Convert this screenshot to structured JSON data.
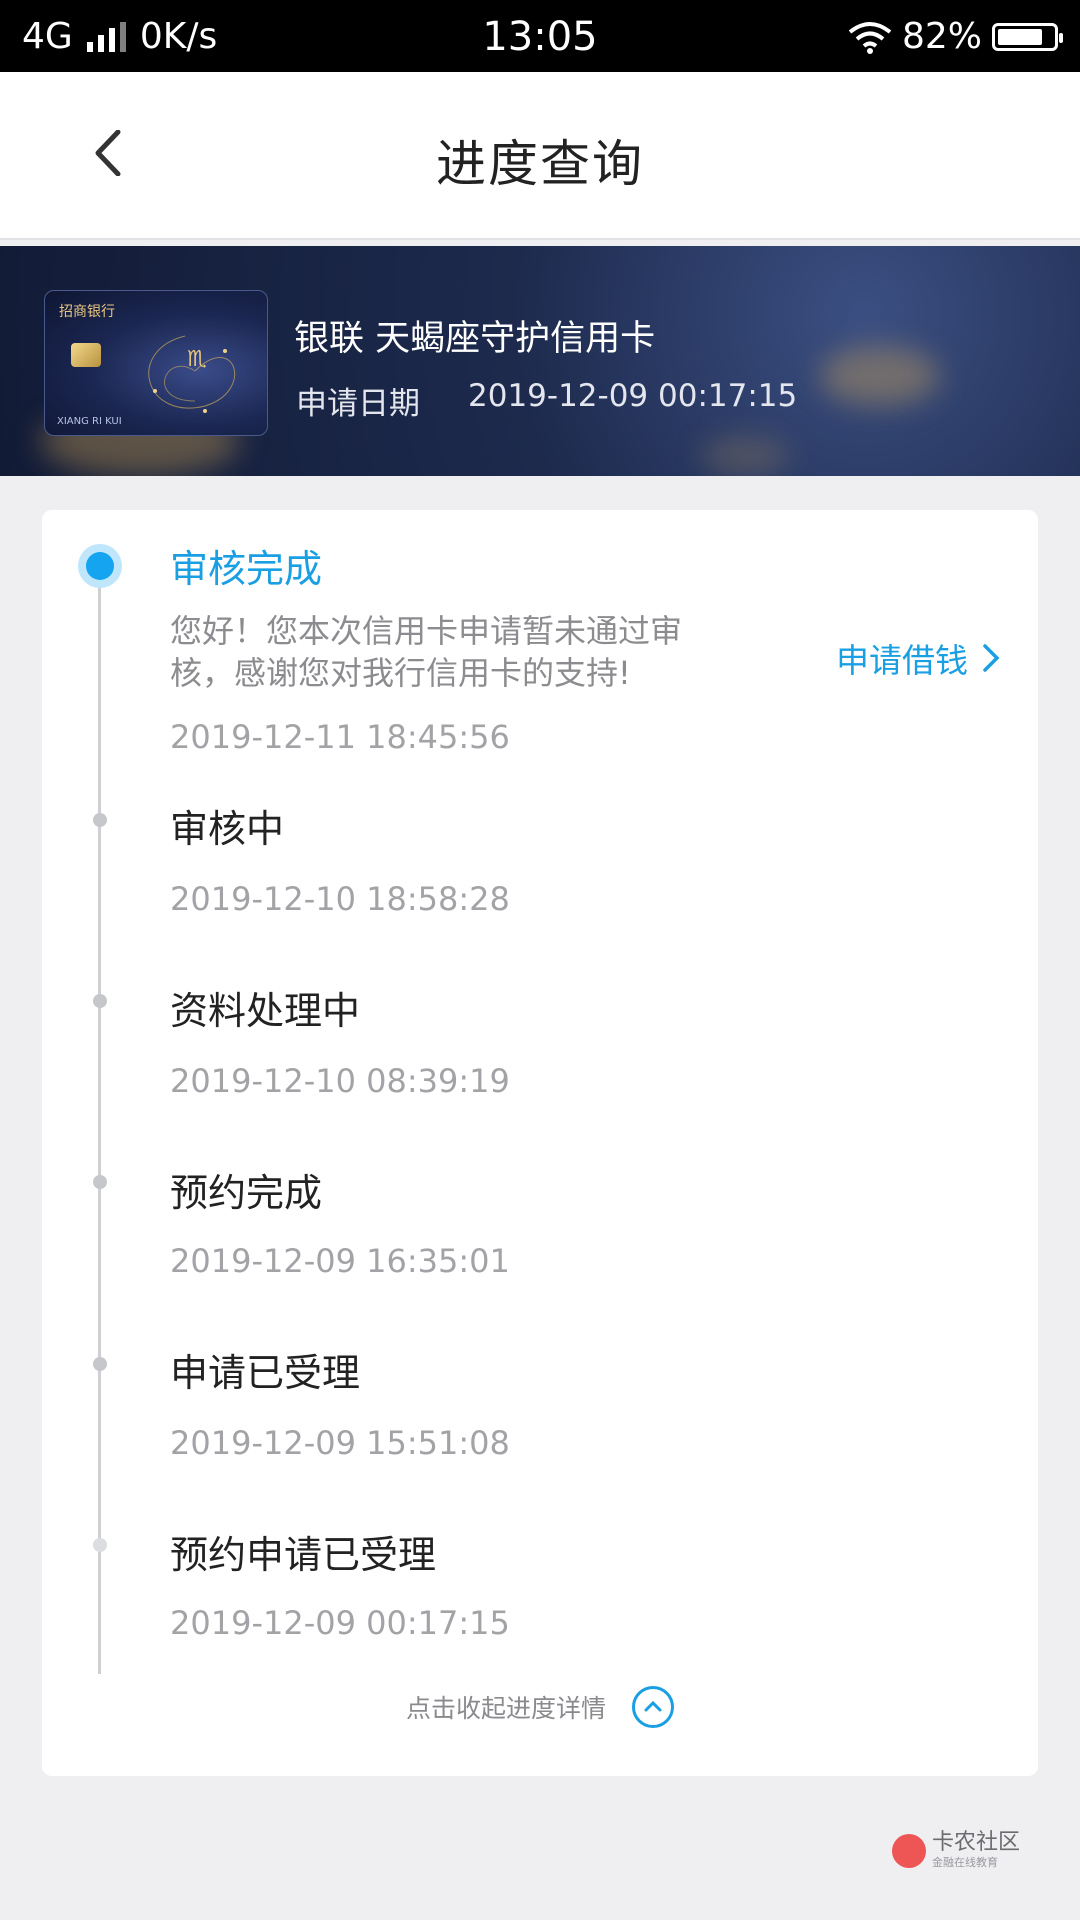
{
  "status_bar": {
    "network": "4G",
    "speed": "0K/s",
    "time": "13:05",
    "battery": "82%",
    "battery_level": 0.82
  },
  "header": {
    "title": "进度查询",
    "back_icon": "chevron-left-icon"
  },
  "card": {
    "bank_name": "招商银行",
    "card_footer": "XIANG RI KUI",
    "card_symbol": "♏",
    "name": "银联 天蝎座守护信用卡",
    "apply_date_label": "申请日期",
    "apply_date": "2019-12-09 00:17:15"
  },
  "progress": {
    "active": {
      "title": "审核完成",
      "description": "您好！您本次信用卡申请暂未通过审核，感谢您对我行信用卡的支持!",
      "time": "2019-12-11 18:45:56",
      "action_label": "申请借钱"
    },
    "steps": [
      {
        "title": "审核中",
        "time": "2019-12-10 18:58:28"
      },
      {
        "title": "资料处理中",
        "time": "2019-12-10 08:39:19"
      },
      {
        "title": "预约完成",
        "time": "2019-12-09 16:35:01"
      },
      {
        "title": "申请已受理",
        "time": "2019-12-09 15:51:08"
      },
      {
        "title": "预约申请已受理",
        "time": "2019-12-09 00:17:15"
      }
    ],
    "collapse_label": "点击收起进度详情"
  },
  "watermark": {
    "name": "卡农社区",
    "slogan": "金融在线教育"
  },
  "colors": {
    "accent": "#1a9fe3",
    "banner": "#1d2a4d"
  }
}
